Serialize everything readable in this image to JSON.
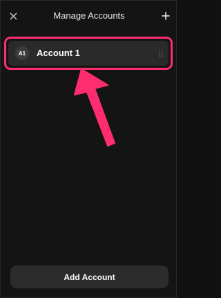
{
  "header": {
    "title": "Manage Accounts",
    "close_icon": "close-icon",
    "add_icon": "plus-icon"
  },
  "accounts": [
    {
      "avatar_initials": "A1",
      "name": "Account 1",
      "handle_icon": "drag-handle-icon"
    }
  ],
  "footer": {
    "add_account_label": "Add Account"
  },
  "colors": {
    "background": "#141414",
    "row_background": "#2a2a2a",
    "highlight": "#ff2d6f",
    "button_background": "#2c2c2c"
  }
}
